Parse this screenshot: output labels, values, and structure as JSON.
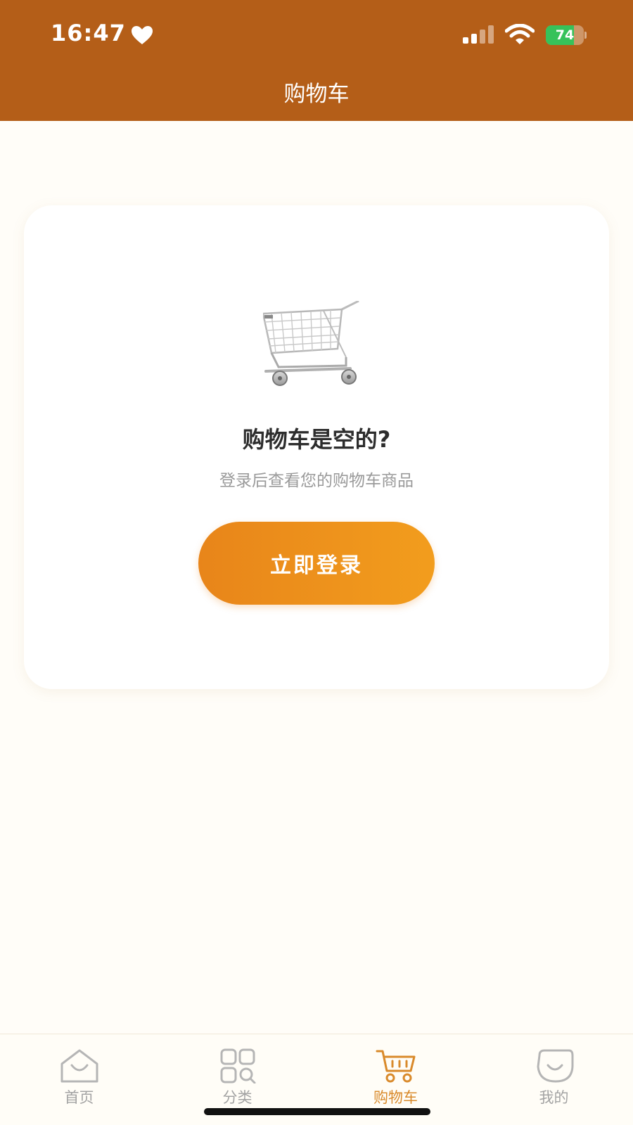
{
  "status_bar": {
    "time": "16:47",
    "battery_level": "74",
    "battery_fraction": 0.74,
    "icons": [
      "heart-icon",
      "signal-icon",
      "wifi-icon",
      "battery-charging-icon"
    ]
  },
  "header": {
    "title": "购物车"
  },
  "empty_state": {
    "illustration": "shopping-cart-illustration",
    "title": "购物车是空的?",
    "subtitle": "登录后查看您的购物车商品",
    "login_button_label": "立即登录"
  },
  "tab_bar": {
    "active_index": 2,
    "items": [
      {
        "label": "首页",
        "icon": "home-icon"
      },
      {
        "label": "分类",
        "icon": "category-grid-icon"
      },
      {
        "label": "购物车",
        "icon": "cart-icon"
      },
      {
        "label": "我的",
        "icon": "profile-icon"
      }
    ]
  },
  "colors": {
    "header_bg": "#b45e18",
    "accent": "#f29d1d",
    "active_tab": "#d98a2b",
    "inactive_tab": "#a3a3a3",
    "battery_green": "#36c25a"
  }
}
